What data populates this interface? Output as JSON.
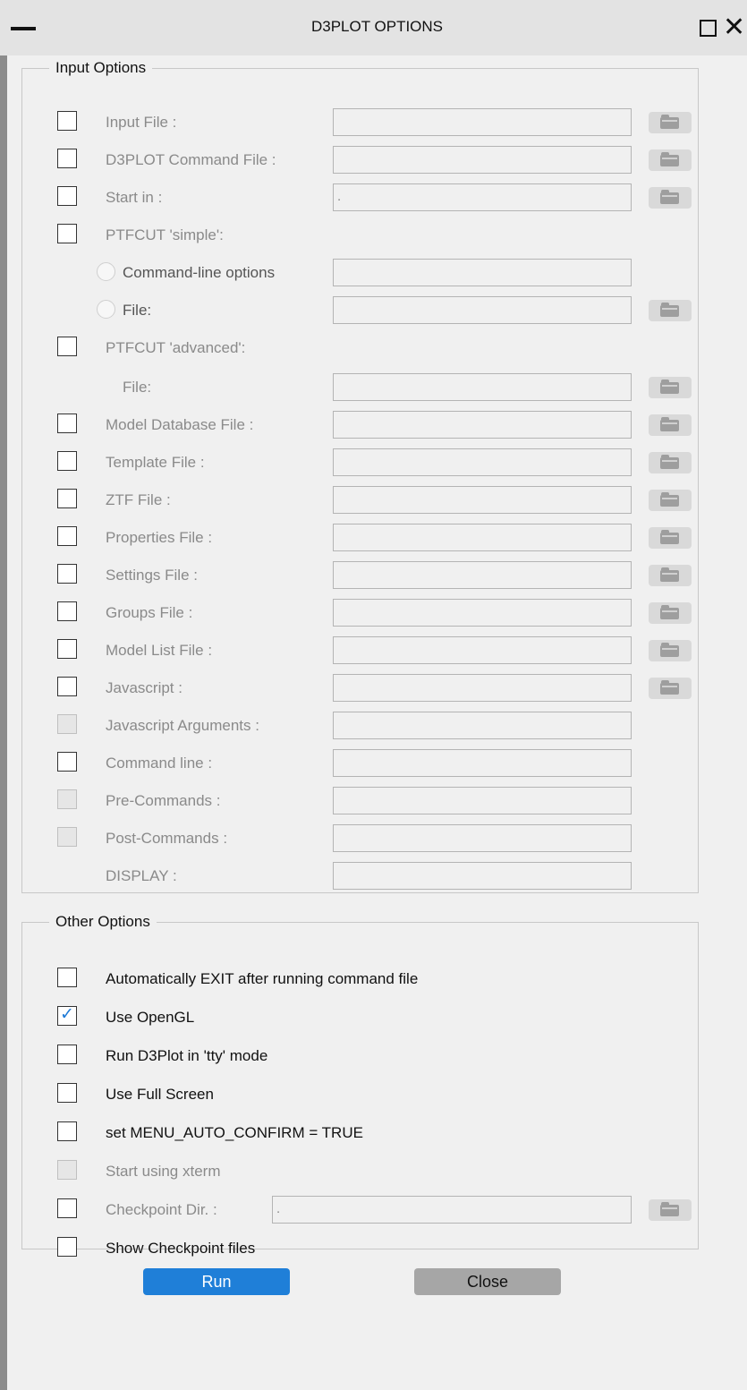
{
  "window": {
    "title": "D3PLOT OPTIONS"
  },
  "input_options": {
    "legend": "Input Options",
    "rows": [
      {
        "label": "Input File :",
        "value": ""
      },
      {
        "label": "D3PLOT Command File :",
        "value": ""
      },
      {
        "label": "Start in :",
        "value": "."
      },
      {
        "label": "PTFCUT 'simple':"
      },
      {
        "label": "Command-line options",
        "value": ""
      },
      {
        "label": "File:",
        "value": ""
      },
      {
        "label": "PTFCUT 'advanced':"
      },
      {
        "label": "File:",
        "value": ""
      },
      {
        "label": "Model Database File :",
        "value": ""
      },
      {
        "label": "Template File :",
        "value": ""
      },
      {
        "label": "ZTF File :",
        "value": ""
      },
      {
        "label": "Properties File :",
        "value": ""
      },
      {
        "label": "Settings File :",
        "value": ""
      },
      {
        "label": "Groups File :",
        "value": ""
      },
      {
        "label": "Model List File :",
        "value": ""
      },
      {
        "label": "Javascript :",
        "value": ""
      },
      {
        "label": "Javascript Arguments :",
        "value": ""
      },
      {
        "label": "Command line :",
        "value": ""
      },
      {
        "label": "Pre-Commands :",
        "value": ""
      },
      {
        "label": "Post-Commands :",
        "value": ""
      },
      {
        "label": "DISPLAY :",
        "value": ""
      }
    ]
  },
  "other_options": {
    "legend": "Other Options",
    "rows": [
      {
        "label": "Automatically EXIT after running command file",
        "checked": false
      },
      {
        "label": "Use OpenGL",
        "checked": true
      },
      {
        "label": "Run D3Plot in 'tty' mode",
        "checked": false
      },
      {
        "label": "Use Full Screen",
        "checked": false
      },
      {
        "label": "set MENU_AUTO_CONFIRM = TRUE",
        "checked": false
      },
      {
        "label": "Start using xterm",
        "checked": false
      },
      {
        "label": "Checkpoint Dir. :",
        "value": ".",
        "checked": false
      },
      {
        "label": "Show Checkpoint files",
        "checked": false
      }
    ]
  },
  "buttons": {
    "run": "Run",
    "close": "Close"
  },
  "icons": {
    "browse": "folder-icon",
    "checkbox_check": "check-icon"
  },
  "colors": {
    "accent": "#1f7fd8",
    "check": "#1e7ad6"
  }
}
